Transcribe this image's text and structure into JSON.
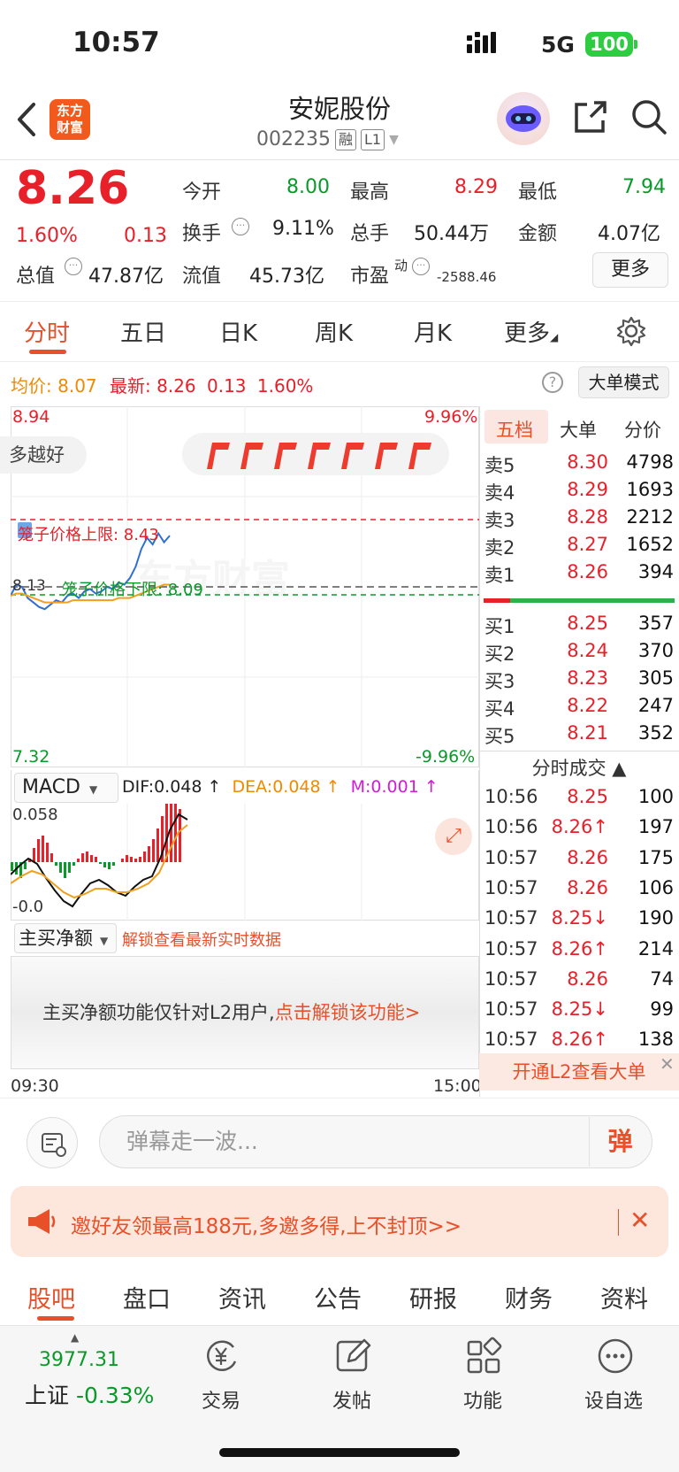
{
  "status": {
    "time": "10:57",
    "network": "5G",
    "battery": "100"
  },
  "header": {
    "logo": "东方\n财富",
    "name": "安妮股份",
    "code": "002235",
    "tag1": "融",
    "tag2": "L1"
  },
  "quote": {
    "last": "8.26",
    "pct": "1.60%",
    "chg": "0.13",
    "open_label": "今开",
    "open": "8.00",
    "high_label": "最高",
    "high": "8.29",
    "low_label": "最低",
    "low": "7.94",
    "turnover_label": "换手",
    "turnover": "9.11%",
    "volume_label": "总手",
    "volume": "50.44万",
    "amount_label": "金额",
    "amount": "4.07亿",
    "mcap_label": "总值",
    "mcap": "47.87亿",
    "float_label": "流值",
    "float": "45.73亿",
    "pe_label": "市盈",
    "pe_sup": "动",
    "pe": "-2588.46",
    "more": "更多"
  },
  "tabs": [
    "分时",
    "五日",
    "日K",
    "周K",
    "月K",
    "更多"
  ],
  "chart": {
    "avg_label": "均价:",
    "avg": "8.07",
    "latest_label": "最新:",
    "latest": "8.26",
    "latest_chg": "0.13",
    "latest_pct": "1.60%",
    "big_order_btn": "大单模式",
    "top_price": "8.94",
    "top_pct": "9.96%",
    "bottom_price": "7.32",
    "bottom_pct": "-9.96%",
    "pill_left": "多越好",
    "upper_limit": "笼子价格上限: 8.43",
    "lower_limit": "笼子价格下限: 8.09",
    "mid_price": "8.13",
    "watermark": "东方财富",
    "time_start": "09:30",
    "time_end": "15:00"
  },
  "chart_data": {
    "type": "line",
    "series": [
      {
        "name": "price",
        "values": [
          8.09,
          8.14,
          8.13,
          8.08,
          8.06,
          8.04,
          8.03,
          8.05,
          8.07,
          8.06,
          8.09,
          8.1,
          8.08,
          8.11,
          8.12,
          8.1,
          8.11,
          8.13,
          8.12,
          8.15,
          8.14,
          8.17,
          8.22,
          8.3,
          8.35,
          8.32,
          8.37,
          8.33,
          8.36
        ]
      },
      {
        "name": "avg",
        "values": [
          8.09,
          8.1,
          8.1,
          8.09,
          8.08,
          8.07,
          8.06,
          8.06,
          8.06,
          8.06,
          8.06,
          8.07,
          8.07,
          8.07,
          8.07,
          8.07,
          8.07,
          8.07,
          8.07,
          8.08,
          8.08,
          8.08,
          8.09,
          8.1,
          8.11,
          8.12,
          8.13,
          8.14,
          8.14
        ]
      }
    ],
    "ylim": [
      7.32,
      8.94
    ]
  },
  "macd": {
    "label": "MACD",
    "dif": "DIF:0.048 ↑",
    "dea": "DEA:0.048 ↑",
    "m": "M:0.001 ↑",
    "top": "0.058",
    "bottom": "-0.0"
  },
  "main_buy": {
    "label": "主买净额",
    "unlock": "解锁查看最新实时数据",
    "note": "主买净额功能仅针对L2用户,",
    "note_link": "点击解锁该功能>"
  },
  "orderbook": {
    "tabs": [
      "五档",
      "大单",
      "分价"
    ],
    "asks": [
      {
        "label": "卖5",
        "price": "8.30",
        "vol": "4798"
      },
      {
        "label": "卖4",
        "price": "8.29",
        "vol": "1693"
      },
      {
        "label": "卖3",
        "price": "8.28",
        "vol": "2212"
      },
      {
        "label": "卖2",
        "price": "8.27",
        "vol": "1652"
      },
      {
        "label": "卖1",
        "price": "8.26",
        "vol": "394"
      }
    ],
    "bids": [
      {
        "label": "买1",
        "price": "8.25",
        "vol": "357"
      },
      {
        "label": "买2",
        "price": "8.24",
        "vol": "370"
      },
      {
        "label": "买3",
        "price": "8.23",
        "vol": "305"
      },
      {
        "label": "买4",
        "price": "8.22",
        "vol": "247"
      },
      {
        "label": "买5",
        "price": "8.21",
        "vol": "352"
      }
    ],
    "trades_title": "分时成交 ▲",
    "trades": [
      {
        "t": "10:56",
        "p": "8.25",
        "v": "100",
        "pc": "red",
        "vc": "green"
      },
      {
        "t": "10:56",
        "p": "8.26↑",
        "v": "197",
        "pc": "red",
        "vc": "red"
      },
      {
        "t": "10:57",
        "p": "8.26",
        "v": "175",
        "pc": "red",
        "vc": "red"
      },
      {
        "t": "10:57",
        "p": "8.26",
        "v": "106",
        "pc": "red",
        "vc": "red"
      },
      {
        "t": "10:57",
        "p": "8.25↓",
        "v": "190",
        "pc": "red",
        "vc": "green"
      },
      {
        "t": "10:57",
        "p": "8.26↑",
        "v": "214",
        "pc": "red",
        "vc": "red"
      },
      {
        "t": "10:57",
        "p": "8.26",
        "v": "74",
        "pc": "red",
        "vc": "red"
      },
      {
        "t": "10:57",
        "p": "8.25↓",
        "v": "99",
        "pc": "red",
        "vc": "green"
      },
      {
        "t": "10:57",
        "p": "8.26↑",
        "v": "138",
        "pc": "red",
        "vc": "red"
      }
    ],
    "l2": "开通L2查看大单"
  },
  "comment": {
    "placeholder": "弹幕走一波...",
    "danmu": "弹"
  },
  "banner": {
    "text": "邀好友领最高188元,多邀多得,上不封顶>>"
  },
  "bottom_tabs": [
    "股吧",
    "盘口",
    "资讯",
    "公告",
    "研报",
    "财务",
    "资料"
  ],
  "toolbar": {
    "index_value": "3977.31",
    "index_name": "上证",
    "index_pct": "-0.33%",
    "items": [
      "交易",
      "发帖",
      "功能",
      "设自选"
    ]
  }
}
